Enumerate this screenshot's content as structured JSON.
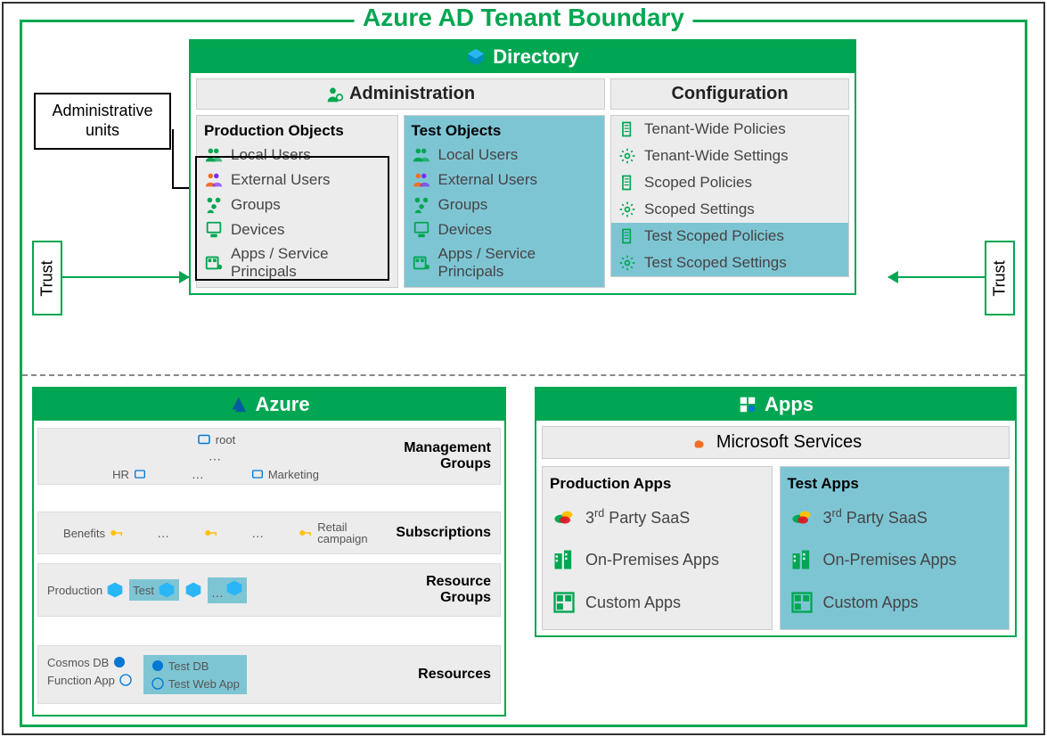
{
  "boundary": {
    "title": "Azure AD Tenant Boundary"
  },
  "admin_units": {
    "label": "Administrative units"
  },
  "trust": {
    "left": "Trust",
    "right": "Trust"
  },
  "directory": {
    "title": "Directory",
    "administration": {
      "title": "Administration",
      "production": {
        "title": "Production Objects",
        "items": [
          "Local Users",
          "External Users",
          "Groups",
          "Devices",
          "Apps / Service Principals"
        ]
      },
      "test": {
        "title": "Test Objects",
        "items": [
          "Local Users",
          "External Users",
          "Groups",
          "Devices",
          "Apps / Service Principals"
        ]
      }
    },
    "configuration": {
      "title": "Configuration",
      "items": [
        {
          "label": "Tenant-Wide Policies",
          "type": "policy",
          "test": false
        },
        {
          "label": "Tenant-Wide Settings",
          "type": "setting",
          "test": false
        },
        {
          "label": "Scoped Policies",
          "type": "policy",
          "test": false
        },
        {
          "label": "Scoped Settings",
          "type": "setting",
          "test": false
        },
        {
          "label": "Test Scoped Policies",
          "type": "policy",
          "test": true
        },
        {
          "label": "Test Scoped Settings",
          "type": "setting",
          "test": true
        }
      ]
    }
  },
  "azure": {
    "title": "Azure",
    "levels": {
      "management_groups": {
        "label": "Management Groups",
        "root": "root",
        "children": [
          "HR",
          "Marketing"
        ]
      },
      "subscriptions": {
        "label": "Subscriptions",
        "items": [
          "Benefits",
          "Retail campaign"
        ]
      },
      "resource_groups": {
        "label": "Resource Groups",
        "items": [
          "Production",
          "Test"
        ]
      },
      "resources": {
        "label": "Resources",
        "prod": [
          "Cosmos DB",
          "Function App"
        ],
        "test": [
          "Test DB",
          "Test Web App"
        ]
      }
    }
  },
  "apps": {
    "title": "Apps",
    "microsoft_services": "Microsoft Services",
    "production": {
      "title": "Production Apps",
      "items": [
        "3rd Party SaaS",
        "On-Premises Apps",
        "Custom Apps"
      ]
    },
    "test": {
      "title": "Test Apps",
      "items": [
        "3rd Party SaaS",
        "On-Premises Apps",
        "Custom Apps"
      ]
    }
  }
}
